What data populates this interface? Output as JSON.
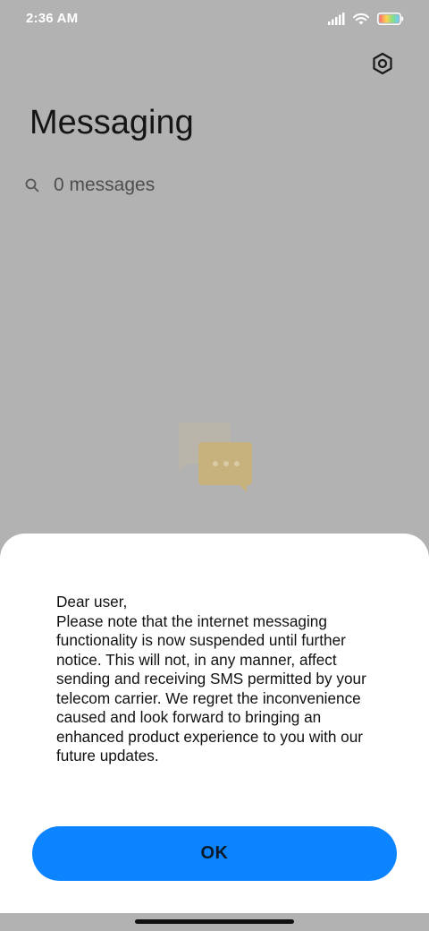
{
  "status_bar": {
    "time": "2:36 AM",
    "icons": [
      "signal-icon",
      "wifi-icon",
      "battery-icon"
    ]
  },
  "header": {
    "title": "Messaging",
    "settings_icon": "gear-icon"
  },
  "search": {
    "text": "0 messages",
    "icon": "search-icon"
  },
  "empty_state": {
    "icon": "chat-bubbles-icon"
  },
  "dialog": {
    "message": "Dear user,\nPlease note that the internet messaging functionality is now suspended until further notice. This will not, in any manner, affect sending and receiving SMS permitted by your telecom carrier. We regret the inconvenience caused and look forward to bringing an enhanced product experience to you with our future updates.",
    "ok_label": "OK"
  },
  "colors": {
    "background_dimmed": "#b2b2b2",
    "accent": "#0d84ff",
    "dialog_bg": "#ffffff"
  }
}
